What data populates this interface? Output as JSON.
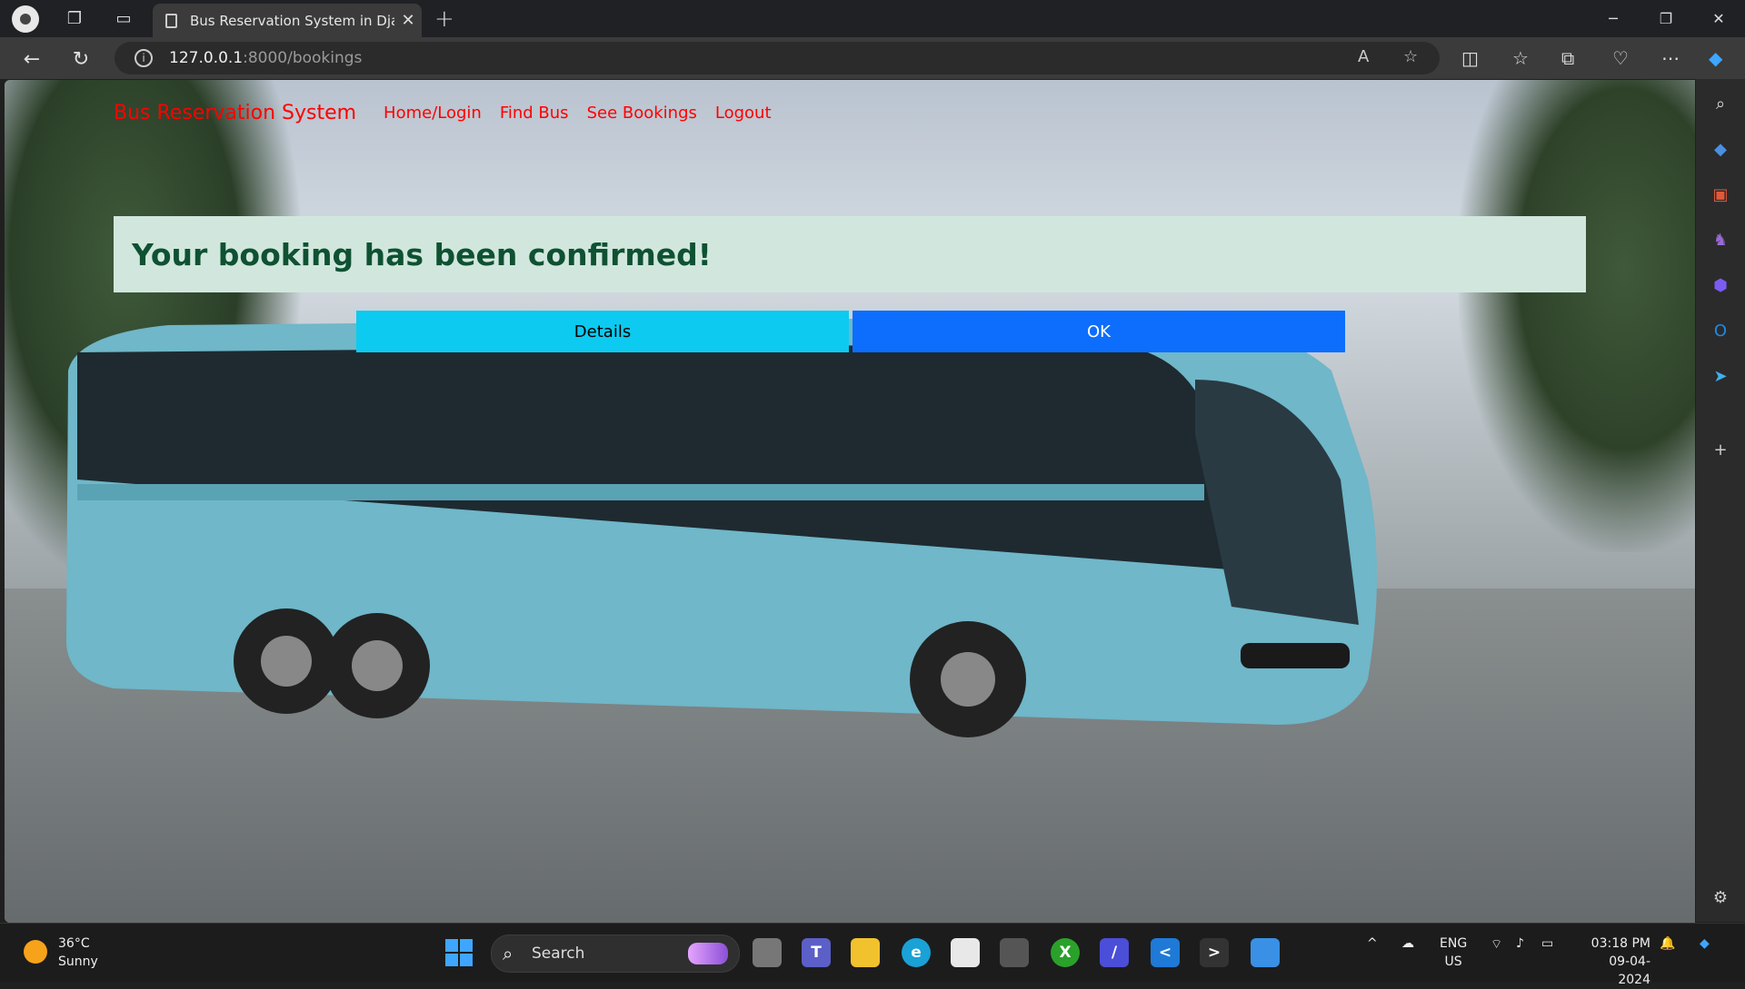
{
  "browser": {
    "tab_title": "Bus Reservation System in Djang",
    "url_host": "127.0.0.1",
    "url_rest": ":8000/bookings",
    "new_tab_symbol": "+",
    "tab_close_symbol": "✕"
  },
  "site": {
    "brand": "Bus Reservation System",
    "nav": [
      "Home/Login",
      "Find Bus",
      "See Bookings",
      "Logout"
    ],
    "alert_text": "Your booking has been confirmed!",
    "details_button": "Details",
    "ok_button": "OK",
    "colors": {
      "brand": "#ff0000",
      "alert_bg": "#d1e7dd",
      "alert_text": "#0f5132",
      "details_bg": "#0dcaf0",
      "ok_bg": "#0d6efd"
    }
  },
  "taskbar": {
    "temperature": "36°C",
    "condition": "Sunny",
    "search_placeholder": "Search",
    "lang_top": "ENG",
    "lang_bottom": "US",
    "time": "03:18 PM",
    "date": "09-04-2024"
  }
}
